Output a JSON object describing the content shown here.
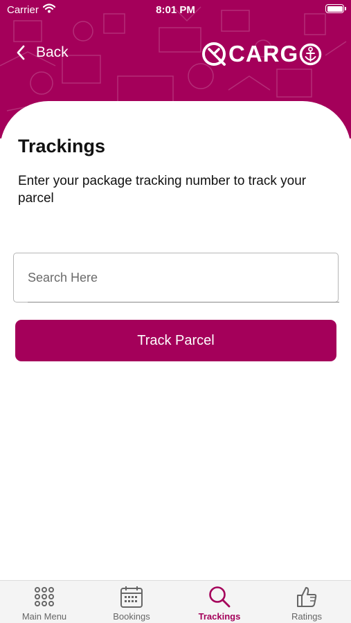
{
  "status_bar": {
    "carrier": "Carrier",
    "time": "8:01 PM"
  },
  "header": {
    "back_label": "Back",
    "logo_text": "CARG",
    "brand_color": "#a4005a"
  },
  "main": {
    "title": "Trackings",
    "subtitle": "Enter your package tracking number to track your parcel",
    "search": {
      "placeholder": "Search Here",
      "value": ""
    },
    "track_button_label": "Track Parcel"
  },
  "tabbar": {
    "items": [
      {
        "label": "Main Menu",
        "icon": "grid-icon",
        "active": false
      },
      {
        "label": "Bookings",
        "icon": "calendar-icon",
        "active": false
      },
      {
        "label": "Trackings",
        "icon": "search-icon",
        "active": true
      },
      {
        "label": "Ratings",
        "icon": "thumbs-up-icon",
        "active": false
      }
    ]
  }
}
